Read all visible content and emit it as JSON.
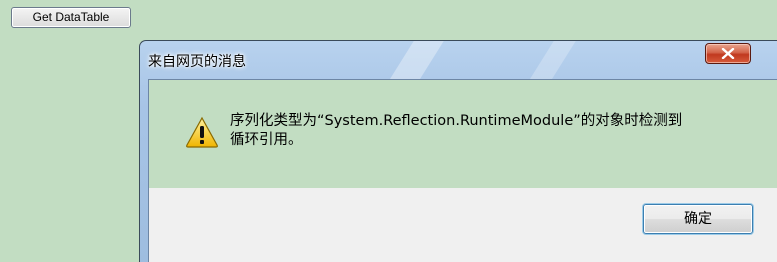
{
  "page": {
    "get_button_label": "Get DataTable"
  },
  "dialog": {
    "title": "来自网页的消息",
    "message_line1": "序列化类型为“System.Reflection.RuntimeModule”的对象时检测到",
    "message_line2": "循环引用。",
    "ok_label": "确定",
    "icon": "warning-icon",
    "close_icon": "close-icon"
  },
  "colors": {
    "page_background": "#c2ddc2",
    "titlebar": "#a7c4e6",
    "close_button": "#c9482e",
    "button_focus": "#3c7fb1"
  }
}
